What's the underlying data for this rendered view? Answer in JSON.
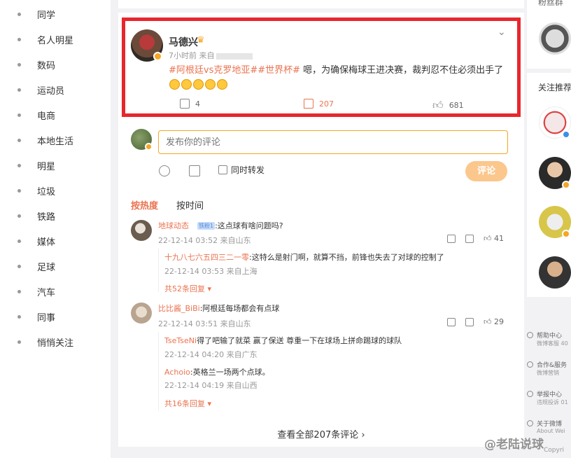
{
  "left_nav": {
    "items": [
      "同学",
      "名人明星",
      "数码",
      "运动员",
      "电商",
      "本地生活",
      "明星",
      "垃圾",
      "铁路",
      "媒体",
      "足球",
      "汽车",
      "同事",
      "悄悄关注"
    ]
  },
  "post": {
    "author": "马德兴",
    "time": "7小时前 来自",
    "hashtags": "#阿根廷vs克罗地亚##世界杯#",
    "text": " 嗯，为确保梅球王进决赛，裁判忍不住必须出手了",
    "forward_count": "4",
    "comment_count": "207",
    "like_count": "681"
  },
  "comment_box": {
    "placeholder": "发布你的评论",
    "also_forward": "同时转发",
    "submit": "评论"
  },
  "sort": {
    "hot": "按热度",
    "time": "按时间"
  },
  "comments": [
    {
      "name": "地球动态",
      "fan_badge": "铁粉1",
      "text": ":这点球有啥问题吗?",
      "time": "22-12-14 03:52 来自山东",
      "likes": "41",
      "replies": [
        {
          "name": "十九八七六五四三二一零",
          "text": ":这特么是射门啊，就算不挡，前锋也失去了对球的控制了",
          "time": "22-12-14 03:53 来自上海"
        }
      ],
      "more": "共52条回复"
    },
    {
      "name": "比比酱_BiBi",
      "text": ":阿根廷每场都会有点球",
      "time": "22-12-14 03:51 来自山东",
      "likes": "29",
      "replies": [
        {
          "name": "TseTseNi",
          "text": "得了吧输了就菜 赢了保送 尊重一下在球场上拼命踢球的球队",
          "time": "22-12-14 04:20 来自广东"
        },
        {
          "name": "Achoio",
          "text": ":英格兰一场两个点球。",
          "time": "22-12-14 04:19 来自山西"
        }
      ],
      "more": "共16条回复"
    }
  ],
  "view_all": "查看全部207条评论 ›",
  "right": {
    "fans_title": "粉丝群",
    "follow_title": "关注推荐",
    "footer": [
      {
        "label": "帮助中心",
        "sub": "微博客服 40"
      },
      {
        "label": "合作&服务",
        "sub": "微博营销"
      },
      {
        "label": "举报中心",
        "sub": "违规投诉 01"
      },
      {
        "label": "关于微博",
        "sub": "About Wei"
      }
    ],
    "copyright": "Copyri"
  },
  "watermark": "@老陆说球",
  "colors": {
    "accent": "#eb7350",
    "highlight": "#e8262d",
    "verified": "#f5a623"
  }
}
